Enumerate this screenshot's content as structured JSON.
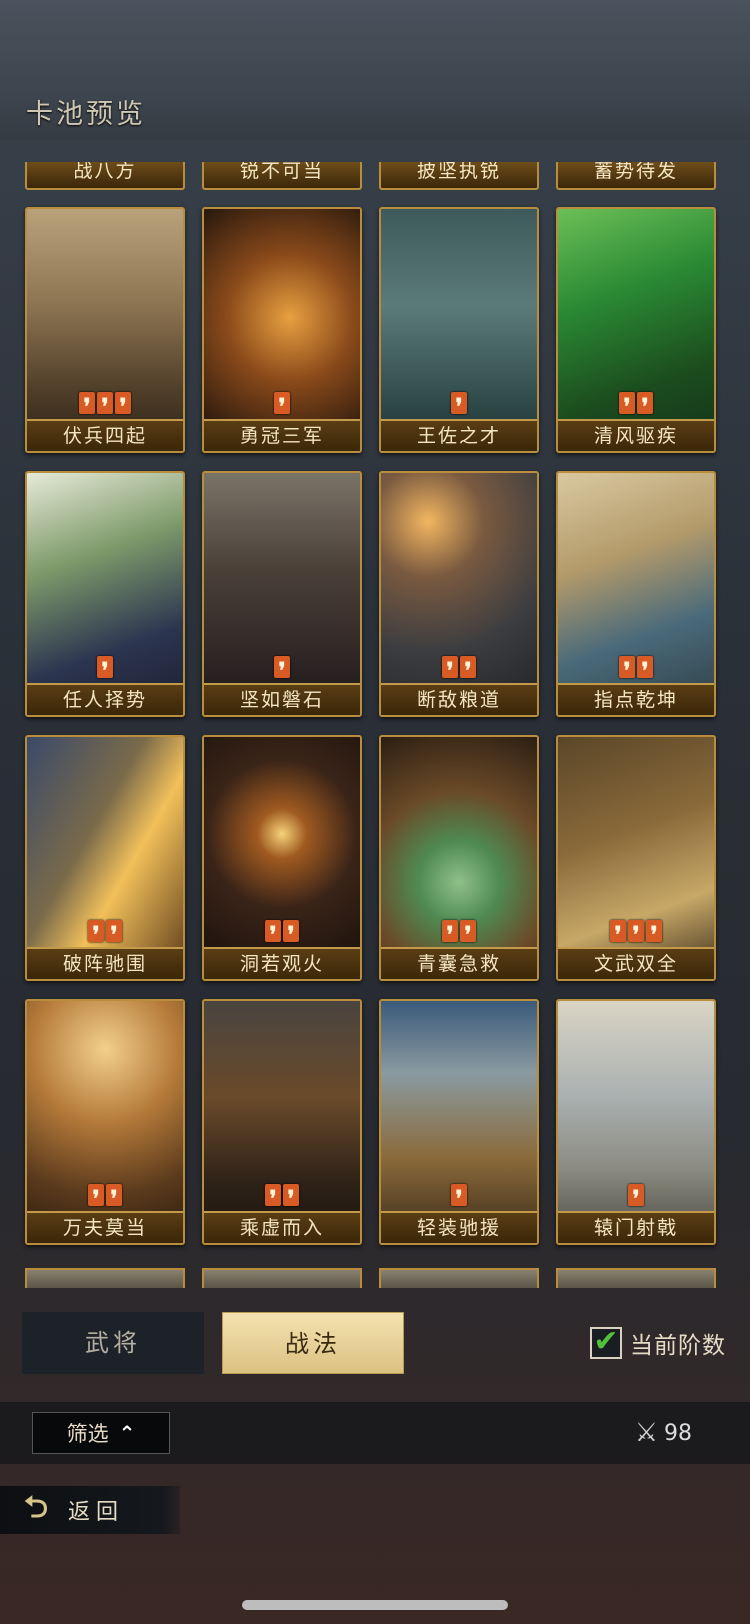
{
  "header": {
    "title": "卡池预览"
  },
  "cards": {
    "top_partial": [
      "战八方",
      "锐不可当",
      "披坚执锐",
      "蓄势待发"
    ],
    "rows": [
      [
        {
          "name": "伏兵四起",
          "quality": 3,
          "art": "ambush-army-art"
        },
        {
          "name": "勇冠三军",
          "quality": 1,
          "art": "brave-warrior-art"
        },
        {
          "name": "王佐之才",
          "quality": 1,
          "art": "tea-fan-art"
        },
        {
          "name": "清风驱疾",
          "quality": 2,
          "art": "green-wind-art"
        }
      ],
      [
        {
          "name": "任人择势",
          "quality": 1,
          "art": "sword-hand-art"
        },
        {
          "name": "坚如磐石",
          "quality": 1,
          "art": "shield-wall-art"
        },
        {
          "name": "断敌粮道",
          "quality": 2,
          "art": "torch-cliff-art"
        },
        {
          "name": "指点乾坤",
          "quality": 2,
          "art": "map-point-art"
        }
      ],
      [
        {
          "name": "破阵驰围",
          "quality": 2,
          "art": "sword-slash-art"
        },
        {
          "name": "洞若观火",
          "quality": 2,
          "art": "candle-art"
        },
        {
          "name": "青囊急救",
          "quality": 2,
          "art": "herb-pouch-art"
        },
        {
          "name": "文武双全",
          "quality": 3,
          "art": "sword-scroll-art"
        }
      ],
      [
        {
          "name": "万夫莫当",
          "quality": 2,
          "art": "lone-warrior-art"
        },
        {
          "name": "乘虚而入",
          "quality": 2,
          "art": "city-gate-art"
        },
        {
          "name": "轻装驰援",
          "quality": 1,
          "art": "cavalry-art"
        },
        {
          "name": "辕门射戟",
          "quality": 1,
          "art": "halberd-art"
        }
      ]
    ],
    "quality_mark": "❜"
  },
  "tabs": {
    "general": "武将",
    "tactics": "战法",
    "active": "tactics"
  },
  "current_tier": {
    "label": "当前阶数",
    "checked": true,
    "check_glyph": "✔"
  },
  "filter": {
    "label": "筛选",
    "chevron": "⌃"
  },
  "count": {
    "value": "98",
    "icon": "crossed-swords-icon",
    "glyph": "⚔"
  },
  "back": {
    "label": "返回",
    "icon_glyph": "⮌"
  }
}
